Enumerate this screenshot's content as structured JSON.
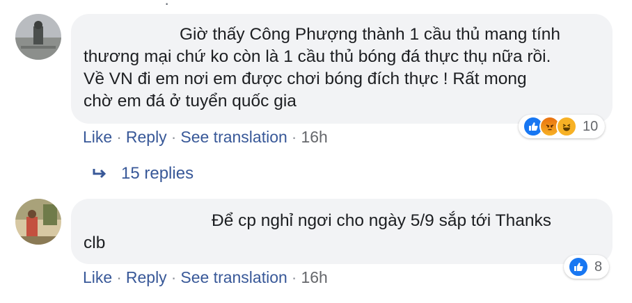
{
  "comments": [
    {
      "text": "Giờ thấy Công Phượng thành 1 cầu thủ mang tính\nthương mại chứ ko còn là 1 cầu thủ bóng đá thực thụ nữa rồi.\nVề VN đi em nơi em được chơi bóng đích thực ! Rất mong\nchờ em đá ở tuyển quốc gia",
      "actions": {
        "like": "Like",
        "reply": "Reply",
        "translate": "See translation",
        "time": "16h"
      },
      "reactions": {
        "icons": [
          "like-icon",
          "angry-icon",
          "haha-icon"
        ],
        "count": "10"
      }
    },
    {
      "text": "Để cp nghỉ ngơi cho ngày 5/9 sắp tới Thanks\nclb",
      "actions": {
        "like": "Like",
        "reply": "Reply",
        "translate": "See translation",
        "time": "16h"
      },
      "reactions": {
        "icons": [
          "like-icon"
        ],
        "count": "8"
      }
    }
  ],
  "replies": {
    "label": "15 replies"
  },
  "colors": {
    "link": "#385898",
    "bubble": "#f2f3f5",
    "like": "#1877f2"
  }
}
